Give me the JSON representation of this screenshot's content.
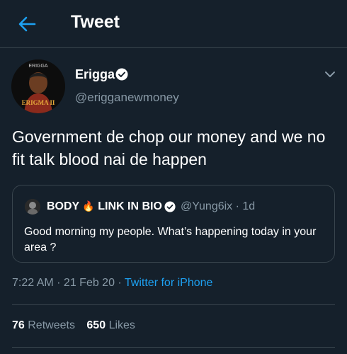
{
  "header": {
    "title": "Tweet",
    "back_icon": "arrow-left-icon"
  },
  "colors": {
    "background": "#15202b",
    "accent": "#1da1f2",
    "muted": "#8899a6",
    "border": "#38444d"
  },
  "tweet": {
    "author": {
      "avatar_text": "ERIGGA",
      "avatar_sub": "ERIGMA II",
      "name": "Erigga",
      "handle": "@erigganewmoney",
      "verified": true
    },
    "text": "Government de chop our money and we no fit talk blood nai de happen",
    "quoted": {
      "name_part1": "BODY",
      "name_emoji": "🔥",
      "name_part2": "LINK IN BIO",
      "handle_time": "@Yung6ix · 1d",
      "text": "Good morning my people. What’s happening today in your area ?"
    },
    "time": "7:22 AM · 21 Feb 20 · ",
    "source": "Twitter for iPhone",
    "retweets_count": "76",
    "retweets_label": "Retweets",
    "likes_count": "650",
    "likes_label": "Likes"
  }
}
